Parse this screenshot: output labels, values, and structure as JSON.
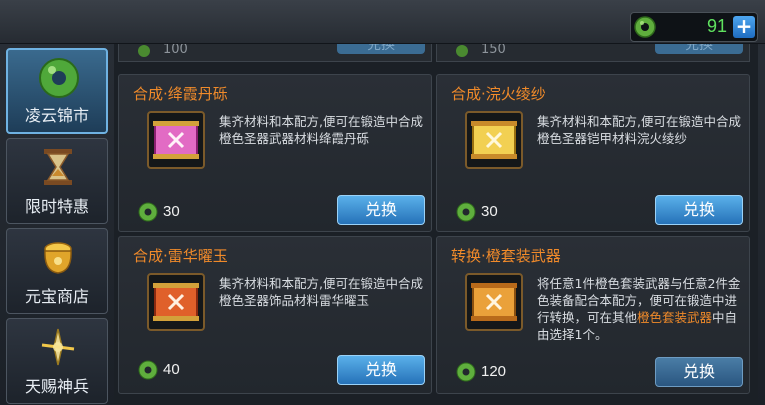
{
  "currency": {
    "amount": "91",
    "plus_label": "+",
    "icon": "jade-coin-icon"
  },
  "sidebar": {
    "items": [
      {
        "label": "凌云锦市",
        "icon": "jade-disc-icon",
        "active": true
      },
      {
        "label": "限时特惠",
        "icon": "hourglass-icon",
        "active": false
      },
      {
        "label": "元宝商店",
        "icon": "gold-ingot-pot-icon",
        "active": false
      },
      {
        "label": "天赐神兵",
        "icon": "divine-weapon-icon",
        "active": false
      }
    ]
  },
  "partial_row": [
    {
      "price": "100",
      "button": "兑换"
    },
    {
      "price": "150",
      "button": "兑换"
    }
  ],
  "cards": [
    {
      "title": "合成·绛霞丹砾",
      "desc": "集齐材料和本配方,便可在锻造中合成橙色圣器武器材料绛霞丹砾",
      "price": "30",
      "button": "兑换",
      "icon": "pink-scroll-icon"
    },
    {
      "title": "合成·浣火绫纱",
      "desc": "集齐材料和本配方,便可在锻造中合成橙色圣器铠甲材料浣火绫纱",
      "price": "30",
      "button": "兑换",
      "icon": "yellow-scroll-icon"
    },
    {
      "title": "合成·雷华曜玉",
      "desc": "集齐材料和本配方,便可在锻造中合成橙色圣器饰品材料雷华曜玉",
      "price": "40",
      "button": "兑换",
      "icon": "red-scroll-icon"
    },
    {
      "title": "转换·橙套装武器",
      "desc_prefix": "将任意1件橙色套装武器与任意2件金色装备配合本配方，便可在锻造中进行转换，可在其他",
      "desc_highlight": "橙色套装武器",
      "desc_suffix": "中自由选择1个。",
      "price": "120",
      "button": "兑换",
      "icon": "orange-scroll-icon"
    }
  ],
  "colors": {
    "accent_orange": "#f08a2a",
    "button_blue": "#3b8fd4",
    "currency_green": "#5fe25f"
  }
}
